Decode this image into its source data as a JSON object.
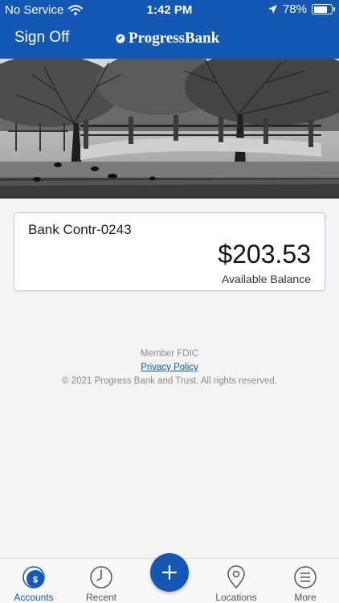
{
  "status_bar": {
    "carrier": "No Service",
    "time": "1:42 PM",
    "battery": "78%",
    "battery_level": 0.78
  },
  "nav": {
    "sign_off": "Sign Off",
    "brand": "ProgressBank"
  },
  "account": {
    "name": "Bank Contr-0243",
    "amount": "$203.53",
    "balance_label": "Available Balance"
  },
  "footer": {
    "member": "Member FDIC",
    "privacy": "Privacy Policy",
    "copyright": "© 2021 Progress Bank and Trust. All rights reserved."
  },
  "tabs": [
    {
      "label": "Accounts",
      "icon": "dollar-icon",
      "active": true
    },
    {
      "label": "Recent",
      "icon": "clock-icon"
    },
    {
      "label": "",
      "icon": "plus-icon"
    },
    {
      "label": "Locations",
      "icon": "location-pin-icon"
    },
    {
      "label": "More",
      "icon": "menu-icon"
    }
  ],
  "colors": {
    "brand_blue": "#1458b4",
    "background": "#f4f4f4",
    "card_border": "#b9cfe6"
  }
}
